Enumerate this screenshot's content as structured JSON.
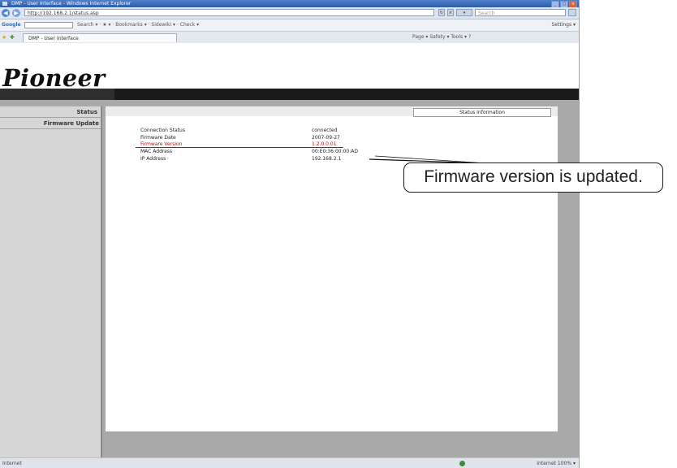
{
  "browser": {
    "window_title": "DMP - User Interface - Windows Internet Explorer",
    "address": "http://192.168.2.1/status.asp",
    "search_placeholder": "Search",
    "google_label": "Google",
    "google_tools": "Search ▾  ·  ★ ▾  ·  Bookmarks ▾  ·  Sidewiki ▾  ·  Check ▾",
    "google_settings": "Settings ▾",
    "tab_title": "DMP - User Interface",
    "command_bar": "Page ▾   Safety ▾   Tools ▾   ?"
  },
  "page": {
    "logo_text": "Pioneer",
    "sidebar": {
      "status_label": "Status",
      "firmware_label": "Firmware Update"
    },
    "status_info_title": "Status Information",
    "rows": [
      {
        "label": "Connection Status",
        "value": "connected"
      },
      {
        "label": "Firmware Date",
        "value": "2007-09-27"
      },
      {
        "label": "Firmware Version",
        "value": "1.2.0.0.01"
      },
      {
        "label": "MAC Address",
        "value": "00:E0:36:00:00:AD"
      },
      {
        "label": "IP Address",
        "value": "192.168.2.1"
      }
    ]
  },
  "statusbar": {
    "left": "Internet",
    "right": "Internet    100% ▾"
  },
  "annotation": {
    "callout_text": "Firmware version is updated."
  },
  "colors": {
    "highlight": "#b01010",
    "header_bar": "#1a1a1a",
    "sidebar_bg": "#d6d6d6"
  }
}
